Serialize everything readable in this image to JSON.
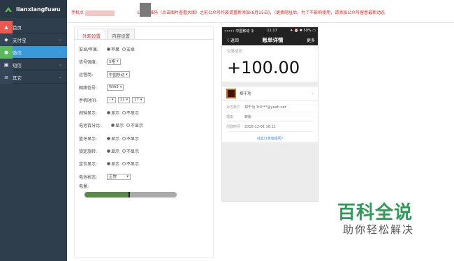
{
  "app": {
    "name": "lianxiangfuwu"
  },
  "sidebar": {
    "items": [
      {
        "label": "首页",
        "icon": "home-icon",
        "glyph": "▲"
      },
      {
        "label": "支付宝",
        "icon": "alipay-icon",
        "glyph": "◆"
      },
      {
        "label": "微信",
        "icon": "wechat-icon",
        "glyph": "●"
      },
      {
        "label": "短信",
        "icon": "sms-icon",
        "glyph": "▣"
      },
      {
        "label": "其它",
        "icon": "menu-icon",
        "glyph": "≡"
      }
    ],
    "chev": "⌄"
  },
  "notice": {
    "part1": "手机点",
    "part2": "公号二维码（点击图片查看大图）之前公众号作废请重新添加(6月15日)，（更换网址后，为了不影响使用，请添加公众号留意最新动态"
  },
  "tabs": [
    {
      "label": "外观设置"
    },
    {
      "label": "内容设置"
    }
  ],
  "form": {
    "os": {
      "label": "安卓/苹果:",
      "opt1": "苹果",
      "opt2": "安卓"
    },
    "signal": {
      "label": "信号强度:",
      "value": "5格"
    },
    "carrier": {
      "label": "运营商:",
      "value": "中国移动"
    },
    "network": {
      "label": "网络信号:",
      "value": "Wifi3"
    },
    "phone_time": {
      "label": "手机时间:",
      "v1": "-",
      "v2": "11",
      "v3": "17"
    },
    "alarm": {
      "label": "闹钟显示:",
      "opt1": "显示",
      "opt2": "不显示"
    },
    "battery_pct": {
      "label": "电池百分比:",
      "opt1": "显示",
      "opt2": "不显示"
    },
    "bluetooth": {
      "label": "蓝牙显示:",
      "opt1": "显示",
      "opt2": "不显示"
    },
    "lock": {
      "label": "锁定旋转:",
      "opt1": "显示",
      "opt2": "不显示"
    },
    "location": {
      "label": "定位显示:",
      "opt1": "显示",
      "opt2": "不显示"
    },
    "battery_status": {
      "label": "电池状态:",
      "value": "正常"
    },
    "battery": {
      "label": "电量:",
      "level": 0.48
    }
  },
  "phone": {
    "status_left": "••••• 中国移动 令",
    "status_time": "11:17",
    "status_right": "✈ ⏰ ✱ 50% ▭",
    "back": "〈 返回",
    "title": "账单详情",
    "more": "更多",
    "trade_status": "交易成功",
    "amount": "+100.00",
    "payee_name": "郑千功",
    "details": [
      {
        "k": "对方账户",
        "v": "郑千功 7r0***@yeah.net"
      },
      {
        "k": "理由",
        "v": "转账"
      },
      {
        "k": "创建时间",
        "v": "2016-12-01 16:11"
      }
    ],
    "question": "对此订单有疑问?"
  },
  "watermark": {
    "title": "百科全说",
    "subtitle": "助你轻松解决"
  }
}
